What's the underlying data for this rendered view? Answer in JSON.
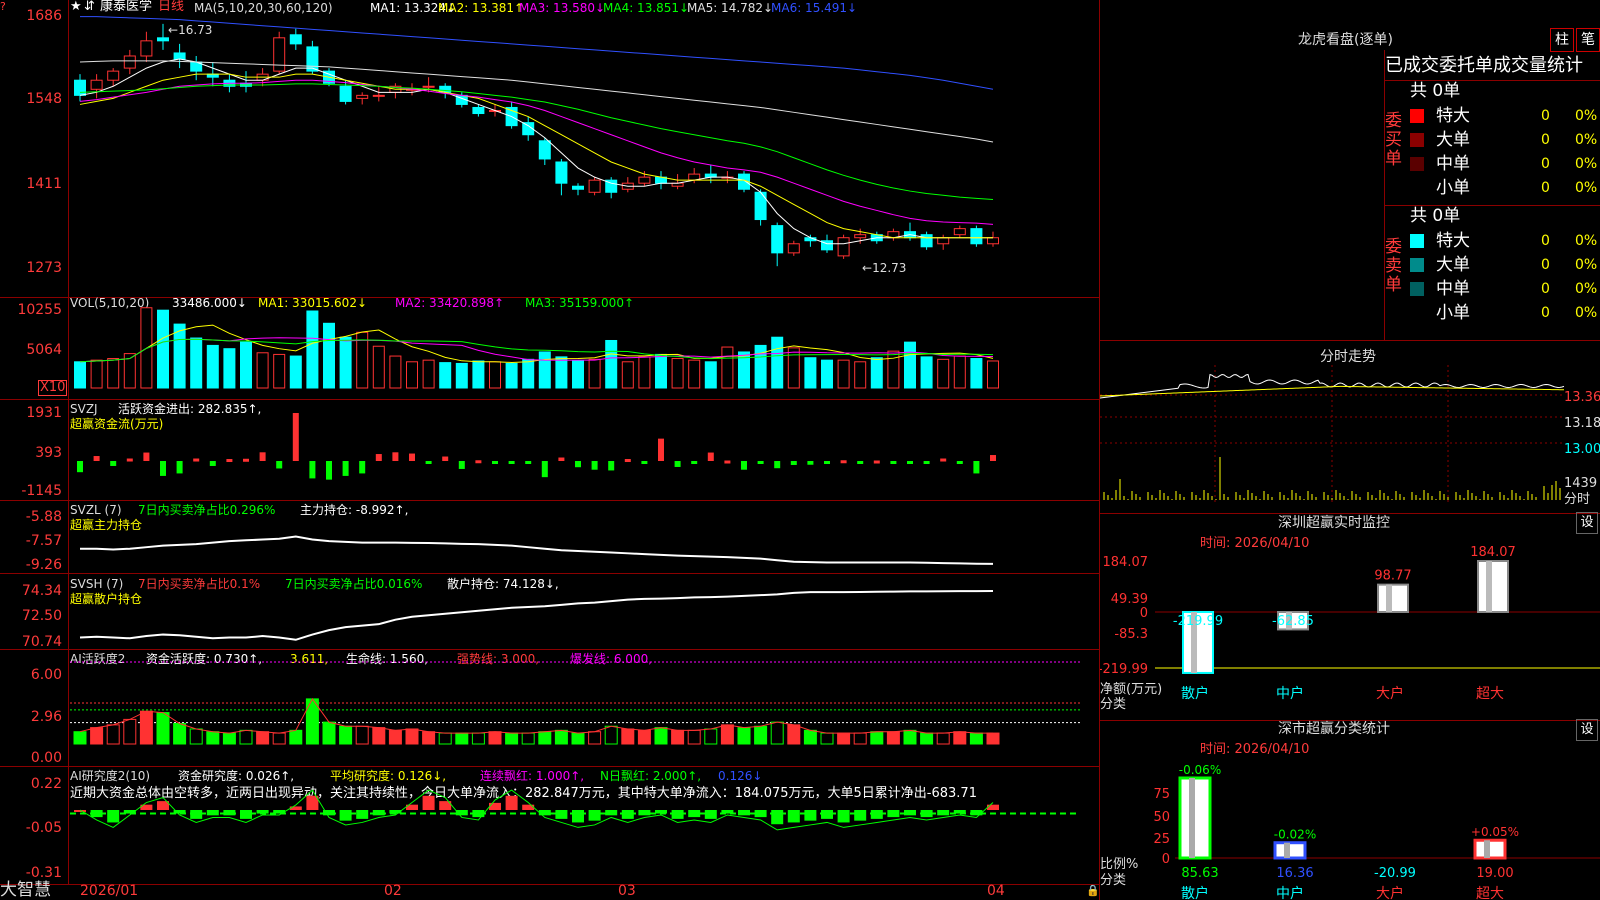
{
  "stock": {
    "name": "康泰医学",
    "period": "日线"
  },
  "price_axis": [
    "1686",
    "1548",
    "1411",
    "1273"
  ],
  "price_marks": {
    "high": "16.73",
    "low": "12.73"
  },
  "ma_legend": {
    "label": "MA(5,10,20,30,60,120)",
    "items": [
      "MA1: 13.324↓",
      "MA2: 13.381↑",
      "MA3: 13.580↓",
      "MA4: 13.851↓",
      "MA5: 14.782↓",
      "MA6: 15.491↓"
    ],
    "colors": [
      "#ffffff",
      "#ffff00",
      "#ff00ff",
      "#00ff00",
      "#e0e0e0",
      "#3050ff"
    ]
  },
  "vol_panel": {
    "axis": [
      "10255",
      "5064"
    ],
    "unit": "X10",
    "legend": {
      "label": "VOL(5,10,20)",
      "items": [
        "33486.000↓",
        "MA1: 33015.602↓",
        "MA2: 33420.898↑",
        "MA3: 35159.000↑"
      ]
    }
  },
  "svzj_panel": {
    "axis": [
      "1931",
      "393",
      "-1145"
    ],
    "line1_label": "SVZJ",
    "line1_text": "活跃资金进出: 282.835↑,",
    "line2": "超赢资金流(万元)"
  },
  "svzl_panel": {
    "axis": [
      "-5.88",
      "-7.57",
      "-9.26"
    ],
    "line1_label": "SVZL (7)",
    "line1_a": "7日内买卖净占比0.296%",
    "line1_b": "主力持仓: -8.992↑,",
    "line2": "超赢主力持仓"
  },
  "svsh_panel": {
    "axis": [
      "74.34",
      "72.50",
      "70.74"
    ],
    "line1_label": "SVSH (7)",
    "line1_a": "7日内买卖净占比0.1%",
    "line1_b": "7日内买卖净占比0.016%",
    "line1_c": "散户持仓: 74.128↓,",
    "line2": "超赢散户持仓"
  },
  "ai_active_panel": {
    "axis": [
      "6.00",
      "2.96",
      "0.00"
    ],
    "label": "AI活跃度2",
    "a": "资金活跃度: 0.730↑,",
    "b": "3.611,",
    "c": "生命线: 1.560,",
    "d": "强势线: 3.000,",
    "e": "爆发线: 6.000,"
  },
  "ai_research_panel": {
    "axis": [
      "0.22",
      "-0.05",
      "-0.31"
    ],
    "label": "AI研究度2(10)",
    "a": "资金研究度: 0.026↑,",
    "b": "平均研究度: 0.126↓,",
    "c": "连续飘红: 1.000↑,",
    "d": "N日飘红: 2.000↑,",
    "e": "0.126↓",
    "comment": "近期大资金总体由空转多，近两日出现异动，关注其持续性，今日大单净流入：282.847万元，其中特大单净流入：184.075万元，大单5日累计净出-683.71"
  },
  "date_axis": {
    "brand": "大智慧",
    "labels": [
      "2026/01",
      "02",
      "03",
      "04"
    ]
  },
  "dragon_tiger": {
    "title": "龙虎看盘(逐单)",
    "btn_bar": "柱",
    "btn_pen": "笔",
    "subtitle": "已成交委托单成交量统计",
    "buy_label": "委买单",
    "sell_label": "委卖单",
    "buy_total": "共 0单",
    "sell_total": "共 0单",
    "rows": [
      {
        "name": "特大",
        "count": "0",
        "pct": "0%"
      },
      {
        "name": "大单",
        "count": "0",
        "pct": "0%"
      },
      {
        "name": "中单",
        "count": "0",
        "pct": "0%"
      },
      {
        "name": "小单",
        "count": "0",
        "pct": "0%"
      }
    ],
    "buy_colors": [
      "#ff0000",
      "#8b0000",
      "#5a0000",
      "#000000"
    ],
    "sell_colors": [
      "#00ffff",
      "#008b8b",
      "#006060",
      "#000000"
    ]
  },
  "intraday": {
    "title": "分时走势",
    "axis": [
      "13.36",
      "13.18",
      "13.00"
    ],
    "vol_axis": "1439",
    "vol_unit": "分时"
  },
  "sz_monitor": {
    "title": "深圳超赢实时监控",
    "btn": "设",
    "time": "时间: 2026/04/10",
    "axis": [
      "184.07",
      "49.39",
      "0",
      "-85.3",
      "-219.99"
    ],
    "net_label": "净额(万元)",
    "cat_label": "分类",
    "categories": [
      "散户",
      "中户",
      "大户",
      "超大"
    ],
    "values": [
      -219.99,
      -62.85,
      98.77,
      184.07
    ],
    "value_labels": [
      "-219.99",
      "-62.85",
      "98.77",
      "184.07"
    ]
  },
  "sz_class": {
    "title": "深市超赢分类统计",
    "btn": "设",
    "time": "时间: 2026/04/10",
    "axis": [
      "75",
      "50",
      "25",
      "0"
    ],
    "ratio_label": "比例%",
    "cat_label": "分类",
    "categories": [
      "散户",
      "中户",
      "大户",
      "超大"
    ],
    "values": [
      85.63,
      16.36,
      -20.99,
      19.0
    ],
    "value_labels": [
      "85.63",
      "16.36",
      "-20.99",
      "19.00"
    ],
    "changes": [
      "-0.06%",
      "-0.02%",
      "",
      "+0.05%"
    ]
  },
  "chart_data": {
    "type": "candlestick",
    "dates": [
      "2026/01",
      "02",
      "03",
      "04"
    ],
    "price_range": [
      12.5,
      16.9
    ],
    "high": 16.73,
    "low": 12.73,
    "candles": [
      [
        15.8,
        15.55,
        15.9,
        15.45
      ],
      [
        15.65,
        15.8,
        15.9,
        15.5
      ],
      [
        15.8,
        15.95,
        16.0,
        15.7
      ],
      [
        16.0,
        16.2,
        16.3,
        15.9
      ],
      [
        16.2,
        16.45,
        16.6,
        16.1
      ],
      [
        16.5,
        16.45,
        16.73,
        16.3
      ],
      [
        16.25,
        16.15,
        16.4,
        16.0
      ],
      [
        16.1,
        15.95,
        16.2,
        15.8
      ],
      [
        15.9,
        15.85,
        16.1,
        15.7
      ],
      [
        15.8,
        15.7,
        15.9,
        15.6
      ],
      [
        15.75,
        15.7,
        15.95,
        15.6
      ],
      [
        15.8,
        15.9,
        16.0,
        15.7
      ],
      [
        15.95,
        16.5,
        16.6,
        15.9
      ],
      [
        16.55,
        16.4,
        16.65,
        16.3
      ],
      [
        16.35,
        15.95,
        16.45,
        15.9
      ],
      [
        15.95,
        15.75,
        16.0,
        15.7
      ],
      [
        15.7,
        15.45,
        15.8,
        15.4
      ],
      [
        15.5,
        15.55,
        15.6,
        15.4
      ],
      [
        15.55,
        15.55,
        15.7,
        15.45
      ],
      [
        15.6,
        15.7,
        15.75,
        15.5
      ],
      [
        15.65,
        15.65,
        15.75,
        15.55
      ],
      [
        15.7,
        15.7,
        15.85,
        15.6
      ],
      [
        15.7,
        15.6,
        15.75,
        15.5
      ],
      [
        15.55,
        15.4,
        15.6,
        15.35
      ],
      [
        15.35,
        15.25,
        15.4,
        15.2
      ],
      [
        15.3,
        15.3,
        15.4,
        15.2
      ],
      [
        15.35,
        15.05,
        15.45,
        15.0
      ],
      [
        15.1,
        14.9,
        15.2,
        14.8
      ],
      [
        14.8,
        14.5,
        14.85,
        14.4
      ],
      [
        14.45,
        14.1,
        14.5,
        13.9
      ],
      [
        14.05,
        14.0,
        14.1,
        13.9
      ],
      [
        13.95,
        14.15,
        14.2,
        13.9
      ],
      [
        14.15,
        13.95,
        14.2,
        13.85
      ],
      [
        14.0,
        14.1,
        14.2,
        13.95
      ],
      [
        14.1,
        14.2,
        14.3,
        14.05
      ],
      [
        14.2,
        14.1,
        14.3,
        14.0
      ],
      [
        14.05,
        14.1,
        14.25,
        14.0
      ],
      [
        14.15,
        14.25,
        14.35,
        14.1
      ],
      [
        14.25,
        14.2,
        14.4,
        14.1
      ],
      [
        14.2,
        14.2,
        14.3,
        14.1
      ],
      [
        14.25,
        14.0,
        14.3,
        13.95
      ],
      [
        13.95,
        13.5,
        14.0,
        13.4
      ],
      [
        13.4,
        12.95,
        13.45,
        12.73
      ],
      [
        12.95,
        13.1,
        13.15,
        12.9
      ],
      [
        13.2,
        13.15,
        13.25,
        13.05
      ],
      [
        13.15,
        13.0,
        13.25,
        12.95
      ],
      [
        12.9,
        13.2,
        13.25,
        12.85
      ],
      [
        13.2,
        13.25,
        13.35,
        13.1
      ],
      [
        13.25,
        13.15,
        13.3,
        13.1
      ],
      [
        13.2,
        13.3,
        13.35,
        13.15
      ],
      [
        13.3,
        13.2,
        13.45,
        13.15
      ],
      [
        13.25,
        13.05,
        13.3,
        13.0
      ],
      [
        13.1,
        13.2,
        13.25,
        13.0
      ],
      [
        13.25,
        13.35,
        13.4,
        13.2
      ],
      [
        13.35,
        13.1,
        13.4,
        13.05
      ],
      [
        13.1,
        13.2,
        13.3,
        13.05
      ]
    ],
    "ma": {
      "MA1": [
        15.55,
        15.6,
        15.7,
        15.85,
        16.0,
        16.1,
        16.15,
        16.1,
        16.0,
        15.9,
        15.8,
        15.8,
        15.9,
        16.0,
        16.0,
        15.9,
        15.8,
        15.7,
        15.6,
        15.6,
        15.6,
        15.65,
        15.6,
        15.5,
        15.4,
        15.3,
        15.2,
        15.05,
        14.85,
        14.6,
        14.35,
        14.2,
        14.1,
        14.05,
        14.05,
        14.1,
        14.1,
        14.15,
        14.2,
        14.2,
        14.15,
        13.95,
        13.6,
        13.35,
        13.2,
        13.1,
        13.1,
        13.15,
        13.2,
        13.2,
        13.25,
        13.2,
        13.2,
        13.2,
        13.2,
        13.2
      ],
      "MA2": [
        15.4,
        15.45,
        15.5,
        15.6,
        15.7,
        15.8,
        15.85,
        15.9,
        15.9,
        15.9,
        15.85,
        15.85,
        15.85,
        15.9,
        15.9,
        15.85,
        15.8,
        15.75,
        15.7,
        15.65,
        15.65,
        15.65,
        15.6,
        15.55,
        15.5,
        15.4,
        15.3,
        15.2,
        15.05,
        14.9,
        14.75,
        14.6,
        14.45,
        14.35,
        14.25,
        14.2,
        14.15,
        14.15,
        14.15,
        14.15,
        14.15,
        14.05,
        13.9,
        13.75,
        13.6,
        13.45,
        13.35,
        13.3,
        13.25,
        13.2,
        13.2,
        13.2,
        13.2,
        13.2,
        13.2,
        13.2
      ],
      "MA3": [
        15.45,
        15.48,
        15.52,
        15.56,
        15.6,
        15.65,
        15.7,
        15.72,
        15.74,
        15.75,
        15.75,
        15.76,
        15.78,
        15.8,
        15.8,
        15.78,
        15.76,
        15.73,
        15.7,
        15.68,
        15.65,
        15.62,
        15.58,
        15.55,
        15.52,
        15.48,
        15.44,
        15.38,
        15.3,
        15.2,
        15.1,
        15.0,
        14.9,
        14.8,
        14.7,
        14.6,
        14.52,
        14.45,
        14.4,
        14.35,
        14.32,
        14.28,
        14.2,
        14.1,
        14.0,
        13.9,
        13.8,
        13.72,
        13.65,
        13.58,
        13.52,
        13.48,
        13.46,
        13.45,
        13.44,
        13.42
      ],
      "MA4": [
        15.6,
        15.61,
        15.62,
        15.63,
        15.64,
        15.66,
        15.68,
        15.7,
        15.71,
        15.72,
        15.72,
        15.72,
        15.73,
        15.74,
        15.74,
        15.73,
        15.72,
        15.71,
        15.7,
        15.68,
        15.67,
        15.65,
        15.63,
        15.61,
        15.58,
        15.55,
        15.52,
        15.48,
        15.44,
        15.38,
        15.32,
        15.25,
        15.18,
        15.12,
        15.06,
        15.0,
        14.95,
        14.9,
        14.85,
        14.8,
        14.76,
        14.7,
        14.62,
        14.52,
        14.42,
        14.32,
        14.23,
        14.15,
        14.08,
        14.02,
        13.97,
        13.93,
        13.9,
        13.87,
        13.85,
        13.83
      ],
      "MA5": [
        16.1,
        16.11,
        16.12,
        16.12,
        16.12,
        16.12,
        16.11,
        16.1,
        16.09,
        16.08,
        16.07,
        16.06,
        16.05,
        16.04,
        16.03,
        16.02,
        16.0,
        15.98,
        15.96,
        15.94,
        15.92,
        15.9,
        15.88,
        15.86,
        15.84,
        15.82,
        15.8,
        15.77,
        15.74,
        15.71,
        15.68,
        15.65,
        15.62,
        15.59,
        15.56,
        15.53,
        15.5,
        15.47,
        15.44,
        15.41,
        15.38,
        15.35,
        15.31,
        15.27,
        15.23,
        15.19,
        15.15,
        15.11,
        15.07,
        15.03,
        14.99,
        14.95,
        14.91,
        14.87,
        14.83,
        14.78
      ],
      "MA6": [
        16.85,
        16.85,
        16.84,
        16.83,
        16.82,
        16.81,
        16.8,
        16.78,
        16.76,
        16.74,
        16.72,
        16.7,
        16.68,
        16.66,
        16.64,
        16.62,
        16.6,
        16.58,
        16.56,
        16.54,
        16.52,
        16.5,
        16.48,
        16.46,
        16.44,
        16.42,
        16.4,
        16.38,
        16.36,
        16.34,
        16.32,
        16.3,
        16.28,
        16.26,
        16.24,
        16.22,
        16.2,
        16.18,
        16.16,
        16.14,
        16.12,
        16.1,
        16.08,
        16.06,
        16.04,
        16.02,
        16.0,
        15.97,
        15.94,
        15.91,
        15.88,
        15.84,
        15.8,
        15.75,
        15.7,
        15.65
      ]
    },
    "volume": [
      3200,
      3400,
      3600,
      4200,
      9800,
      9500,
      7800,
      6100,
      5200,
      4800,
      5600,
      4300,
      4100,
      3900,
      9400,
      7900,
      6200,
      6800,
      5100,
      3900,
      3200,
      3400,
      3100,
      3000,
      3300,
      3200,
      3000,
      3500,
      4400,
      3800,
      3300,
      3500,
      5800,
      3200,
      3800,
      4100,
      3600,
      3400,
      3200,
      5000,
      4400,
      5200,
      6200,
      4900,
      3700,
      3400,
      3400,
      3200,
      3700,
      4500,
      5600,
      3800,
      3500,
      3900,
      3600,
      3300
    ],
    "active_fund": [
      -450,
      200,
      -200,
      100,
      340,
      -600,
      -500,
      100,
      -200,
      80,
      90,
      350,
      -300,
      1931,
      -700,
      -750,
      -600,
      -500,
      280,
      350,
      300,
      -30,
      180,
      -320,
      30,
      -40,
      -60,
      -15,
      -650,
      140,
      -250,
      -350,
      -380,
      80,
      -50,
      900,
      -240,
      -70,
      340,
      20,
      -350,
      -100,
      -290,
      -160,
      -150,
      -50,
      30,
      -70,
      20,
      -15,
      -70,
      -30,
      100,
      -25,
      -500,
      240
    ],
    "main_hold": [
      -8.0,
      -8.0,
      -8.05,
      -8.0,
      -7.9,
      -7.8,
      -7.75,
      -7.7,
      -7.6,
      -7.5,
      -7.45,
      -7.4,
      -7.35,
      -7.2,
      -7.4,
      -7.5,
      -7.55,
      -7.6,
      -7.6,
      -7.6,
      -7.62,
      -7.63,
      -7.65,
      -7.68,
      -7.7,
      -7.75,
      -7.8,
      -7.9,
      -8.0,
      -8.1,
      -8.15,
      -8.2,
      -8.25,
      -8.3,
      -8.35,
      -8.4,
      -8.45,
      -8.48,
      -8.52,
      -8.55,
      -8.6,
      -8.65,
      -8.75,
      -8.85,
      -8.88,
      -8.9,
      -8.9,
      -8.9,
      -8.9,
      -8.9,
      -8.9,
      -8.92,
      -8.94,
      -8.96,
      -8.98,
      -8.99
    ],
    "retail_hold": [
      71.0,
      71.05,
      71.0,
      70.95,
      71.1,
      71.2,
      71.15,
      71.05,
      70.95,
      71.0,
      71.0,
      71.1,
      71.0,
      70.85,
      71.2,
      71.5,
      71.7,
      71.8,
      71.9,
      72.2,
      72.4,
      72.5,
      72.6,
      72.7,
      72.8,
      72.9,
      73.0,
      73.05,
      73.1,
      73.2,
      73.3,
      73.35,
      73.45,
      73.55,
      73.6,
      73.62,
      73.65,
      73.7,
      73.72,
      73.75,
      73.8,
      73.85,
      73.9,
      74.0,
      74.05,
      74.05,
      74.05,
      74.06,
      74.08,
      74.09,
      74.1,
      74.1,
      74.11,
      74.12,
      74.12,
      74.13
    ],
    "activity": [
      0.9,
      1.2,
      1.4,
      1.8,
      2.4,
      2.3,
      1.5,
      1.1,
      0.9,
      0.8,
      1.0,
      0.9,
      0.8,
      1.0,
      3.3,
      1.6,
      1.3,
      1.3,
      1.2,
      1.0,
      1.1,
      0.9,
      0.8,
      0.8,
      0.8,
      0.9,
      0.8,
      0.8,
      0.9,
      1.0,
      0.8,
      0.9,
      1.3,
      1.1,
      1.0,
      1.2,
      1.0,
      1.0,
      1.1,
      1.4,
      1.2,
      1.3,
      1.6,
      1.4,
      1.0,
      0.8,
      0.8,
      0.8,
      0.9,
      0.9,
      1.0,
      0.8,
      0.8,
      0.9,
      0.8,
      0.8
    ],
    "research": [
      0.0,
      -0.04,
      -0.07,
      -0.02,
      0.03,
      0.05,
      -0.02,
      -0.05,
      -0.03,
      -0.03,
      -0.05,
      -0.02,
      -0.02,
      0.02,
      0.08,
      -0.03,
      -0.06,
      -0.05,
      -0.03,
      -0.02,
      0.03,
      0.08,
      0.05,
      -0.03,
      -0.04,
      0.04,
      0.08,
      0.03,
      -0.03,
      -0.05,
      -0.07,
      -0.06,
      -0.03,
      -0.05,
      -0.03,
      -0.02,
      -0.05,
      -0.04,
      -0.05,
      -0.02,
      -0.03,
      -0.04,
      -0.08,
      -0.07,
      -0.06,
      -0.05,
      -0.07,
      -0.06,
      -0.05,
      -0.04,
      -0.03,
      -0.04,
      -0.03,
      -0.02,
      -0.03,
      0.03
    ]
  }
}
